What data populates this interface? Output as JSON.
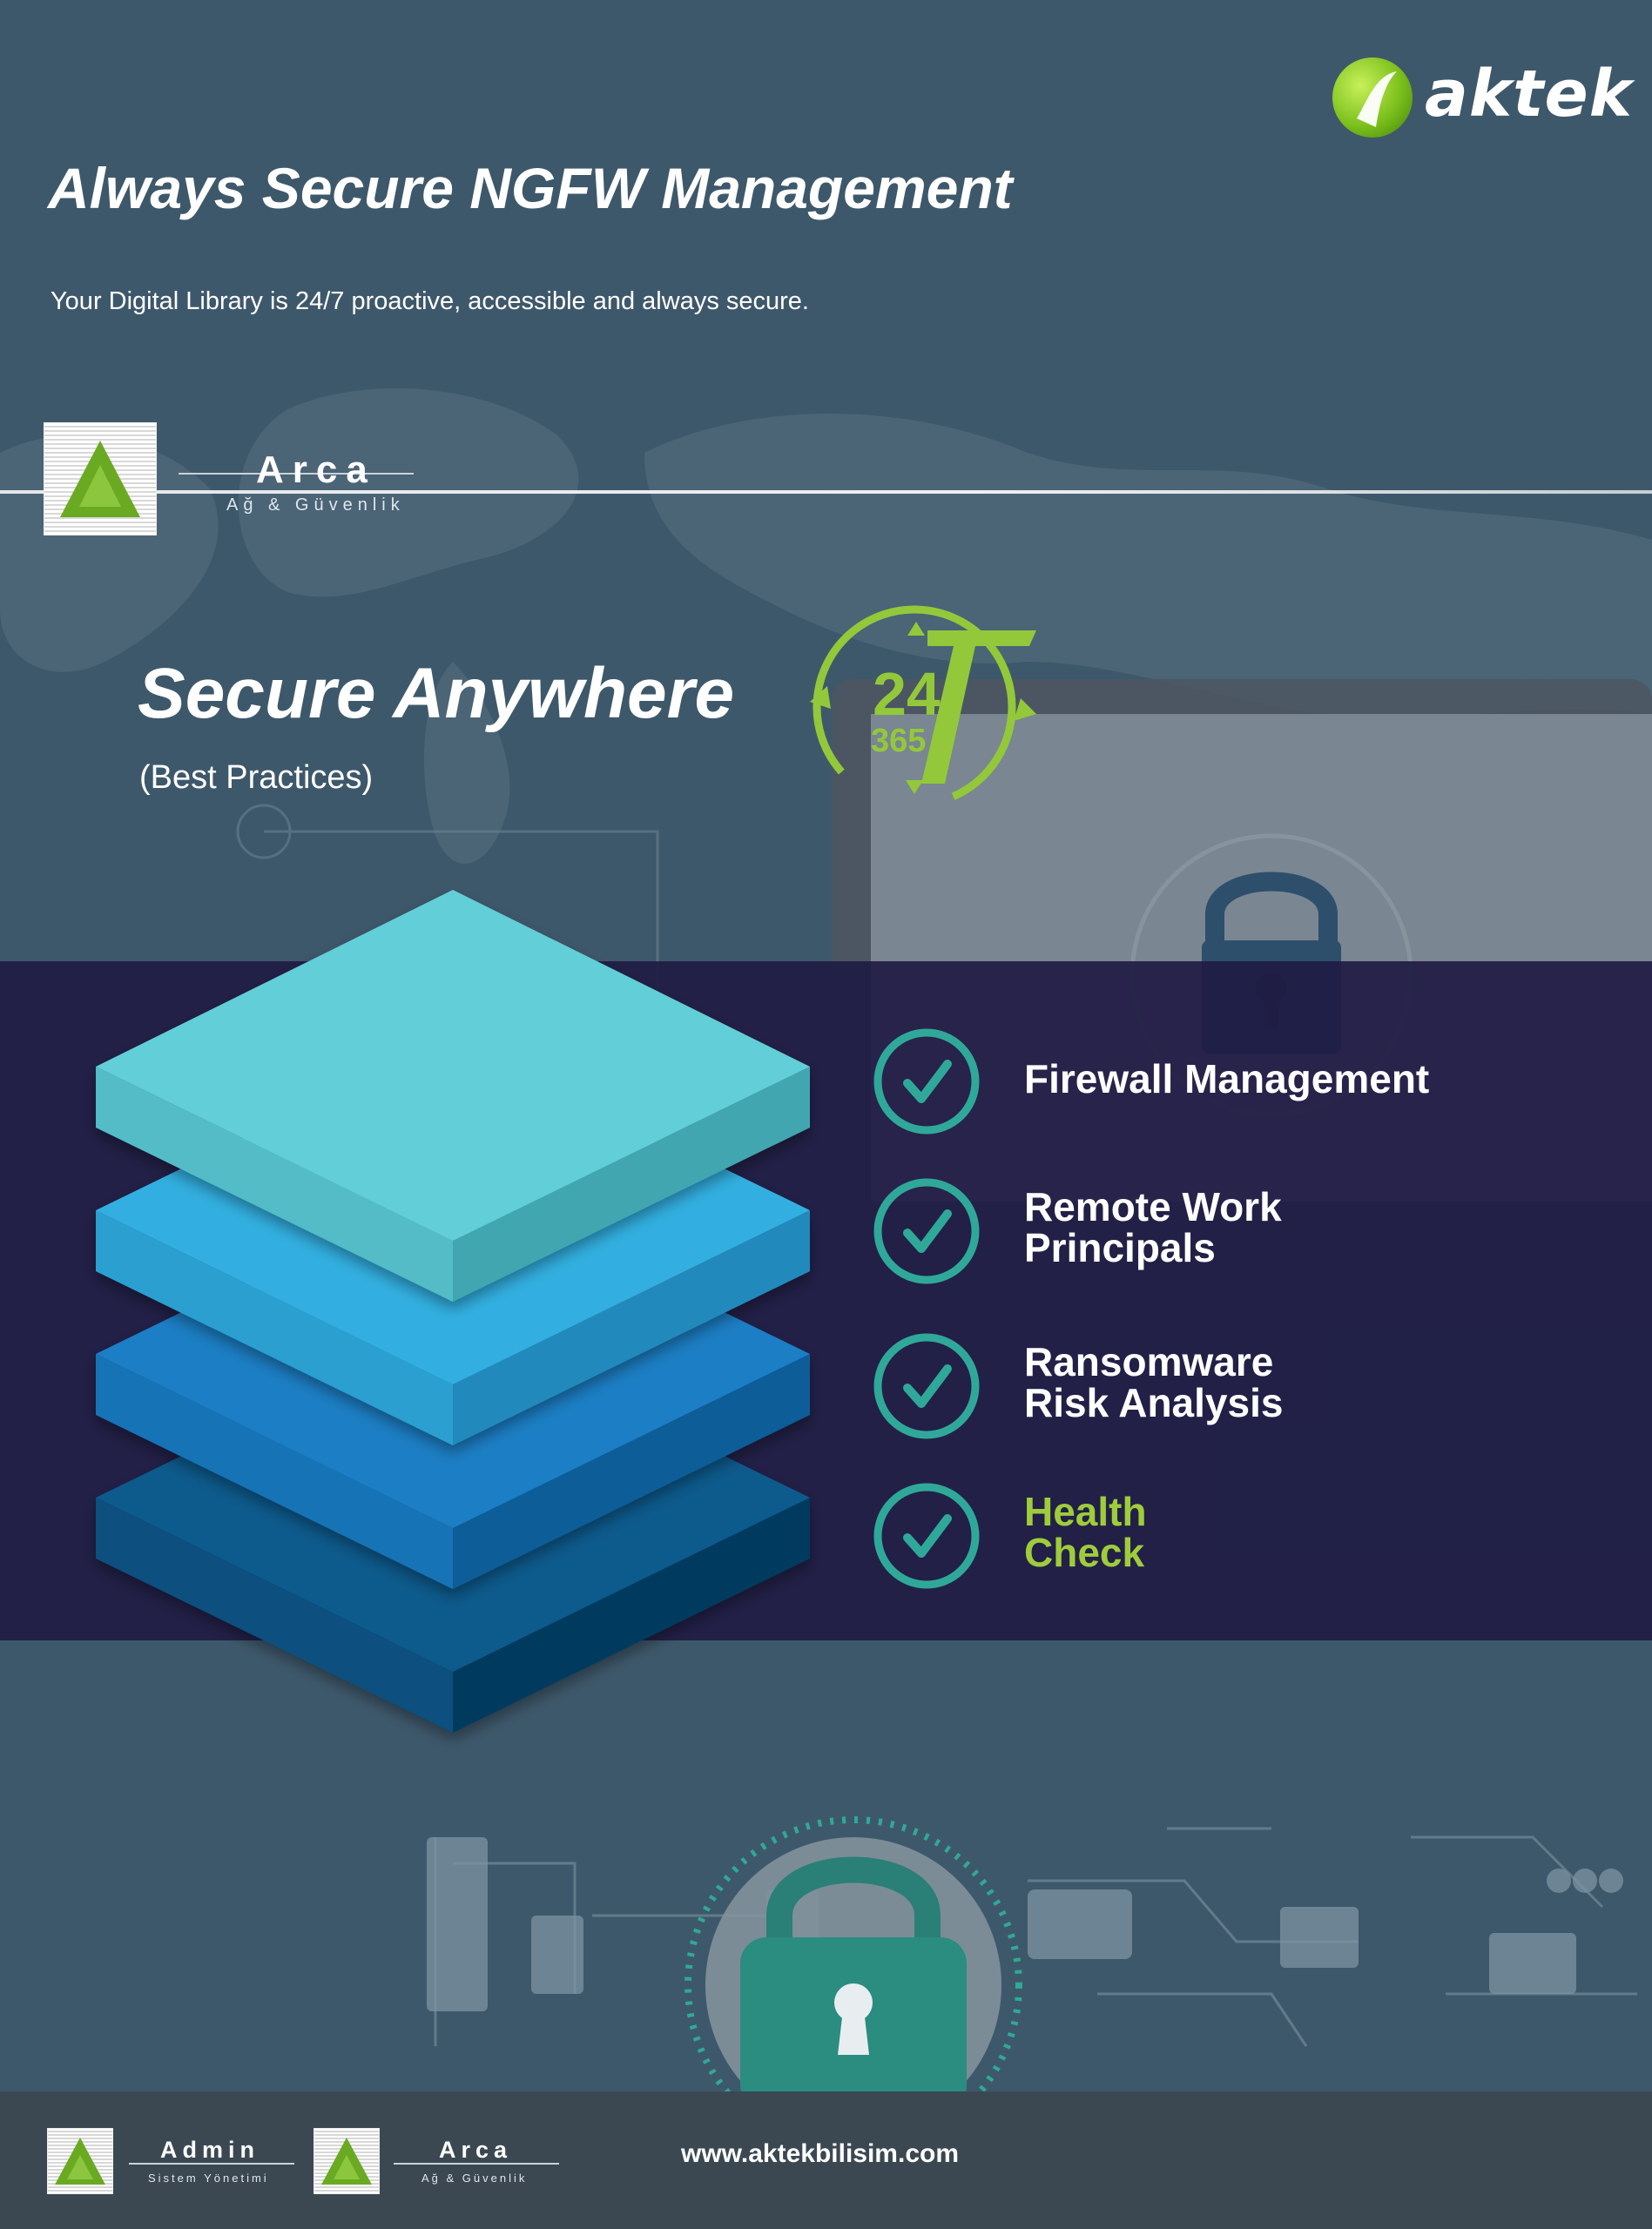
{
  "brand": {
    "name": "aktek"
  },
  "header": {
    "title": "Always Secure NGFW Management",
    "subtitle": "Your Digital Library is 24/7 proactive, accessible and always secure."
  },
  "arca_logo": {
    "name": "Arca",
    "tagline": "Ağ & Güvenlik"
  },
  "hero": {
    "headline": "Secure Anywhere",
    "subheadline": "(Best Practices)"
  },
  "badge": {
    "big_number": "24",
    "small_number": "365",
    "digit": "7"
  },
  "features": [
    {
      "line1": "Firewall Management",
      "line2": "",
      "highlight": false
    },
    {
      "line1": "Remote Work",
      "line2": "Principals",
      "highlight": false
    },
    {
      "line1": "Ransomware",
      "line2": "Risk Analysis",
      "highlight": false
    },
    {
      "line1": "Health",
      "line2": "Check",
      "highlight": true
    }
  ],
  "footer": {
    "logos": [
      {
        "name": "Admin",
        "tagline": "Sistem Yönetimi"
      },
      {
        "name": "Arca",
        "tagline": "Ağ & Güvenlik"
      }
    ],
    "url": "www.aktekbilisim.com"
  },
  "colors": {
    "background": "#3e586b",
    "band": "#1f1b44",
    "accent_green": "#9fcc3b",
    "check_teal": "#2fa89a",
    "layer_colors": [
      "#62ced8",
      "#30afe0",
      "#1a7ec4",
      "#0a5a8c"
    ]
  }
}
